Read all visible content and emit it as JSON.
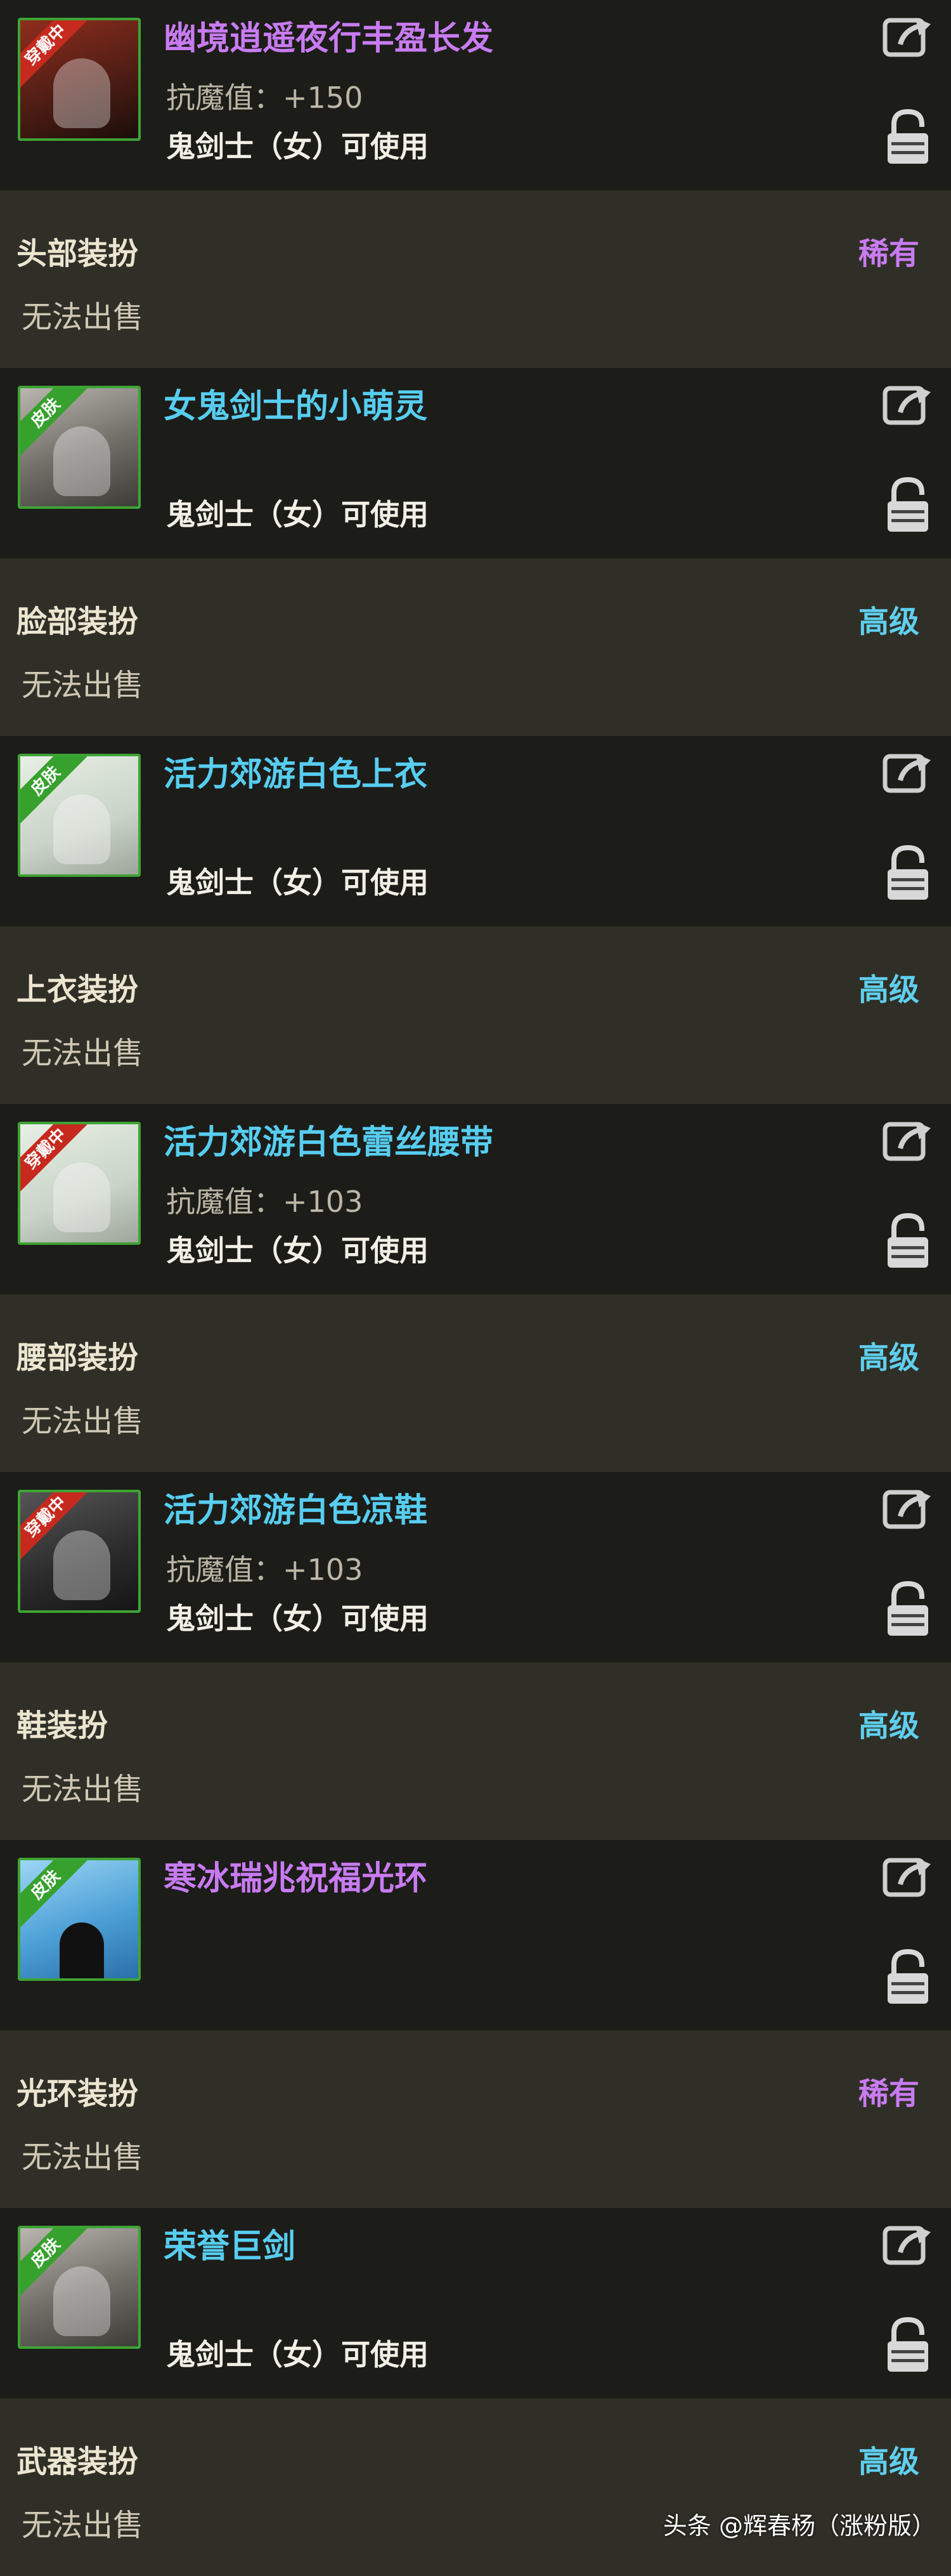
{
  "items": [
    {
      "name": "幽境逍遥夜行丰盈长发",
      "name_color": "purple",
      "badge": "穿戴中",
      "stat": "抗魔值：+150",
      "usable": "鬼剑士（女）可使用",
      "type": "头部装扮",
      "rarity": "稀有",
      "rarity_color": "rare",
      "sell": "无法出售"
    },
    {
      "name": "女鬼剑士的小萌灵",
      "name_color": "blue",
      "badge": "皮肤",
      "stat": "",
      "usable": "鬼剑士（女）可使用",
      "type": "脸部装扮",
      "rarity": "高级",
      "rarity_color": "high",
      "sell": "无法出售"
    },
    {
      "name": "活力郊游白色上衣",
      "name_color": "blue",
      "badge": "皮肤",
      "stat": "",
      "usable": "鬼剑士（女）可使用",
      "type": "上衣装扮",
      "rarity": "高级",
      "rarity_color": "high",
      "sell": "无法出售"
    },
    {
      "name": "活力郊游白色蕾丝腰带",
      "name_color": "blue",
      "badge": "穿戴中",
      "stat": "抗魔值：+103",
      "usable": "鬼剑士（女）可使用",
      "type": "腰部装扮",
      "rarity": "高级",
      "rarity_color": "high",
      "sell": "无法出售"
    },
    {
      "name": "活力郊游白色凉鞋",
      "name_color": "blue",
      "badge": "穿戴中",
      "stat": "抗魔值：+103",
      "usable": "鬼剑士（女）可使用",
      "type": "鞋装扮",
      "rarity": "高级",
      "rarity_color": "high",
      "sell": "无法出售"
    },
    {
      "name": "寒冰瑞兆祝福光环",
      "name_color": "purple",
      "badge": "皮肤",
      "stat": "",
      "usable": "",
      "type": "光环装扮",
      "rarity": "稀有",
      "rarity_color": "rare",
      "sell": "无法出售"
    },
    {
      "name": "荣誉巨剑",
      "name_color": "blue",
      "badge": "皮肤",
      "stat": "",
      "usable": "鬼剑士（女）可使用",
      "type": "武器装扮",
      "rarity": "高级",
      "rarity_color": "high",
      "sell": "无法出售"
    }
  ],
  "watermark": "头条 @辉春杨（涨粉版）",
  "icons": {
    "share": "share-icon",
    "lock": "lock-icon"
  },
  "colors": {
    "purple": "#c87bf2",
    "blue": "#57cdf0",
    "badge_skin": "#37a12e",
    "badge_equip": "#c62a1e"
  }
}
